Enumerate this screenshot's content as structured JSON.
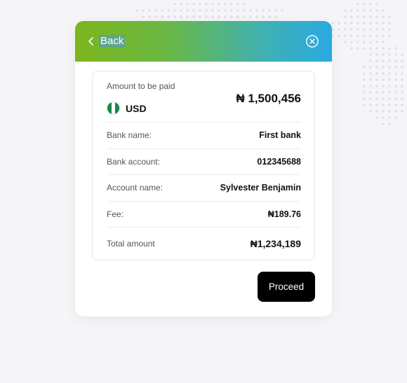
{
  "header": {
    "back_label": "Back",
    "back_icon": "chevron-left-icon",
    "close_icon": "close-circle-icon",
    "gradient": [
      "#7cb51d",
      "#2aa9e2"
    ]
  },
  "payment": {
    "amount_label": "Amount to be paid",
    "currency_code": "USD",
    "currency_flag": "nigeria-flag-icon",
    "amount": "₦ 1,500,456"
  },
  "details": [
    {
      "label": "Bank name:",
      "value": "First bank"
    },
    {
      "label": "Bank account:",
      "value": "012345688"
    },
    {
      "label": "Account name:",
      "value": "Sylvester Benjamin"
    },
    {
      "label": "Fee:",
      "value": "₦189.76"
    },
    {
      "label": "Total amount",
      "value": "₦1,234,189"
    }
  ],
  "actions": {
    "proceed_label": "Proceed",
    "proceed_color": "#000000"
  }
}
